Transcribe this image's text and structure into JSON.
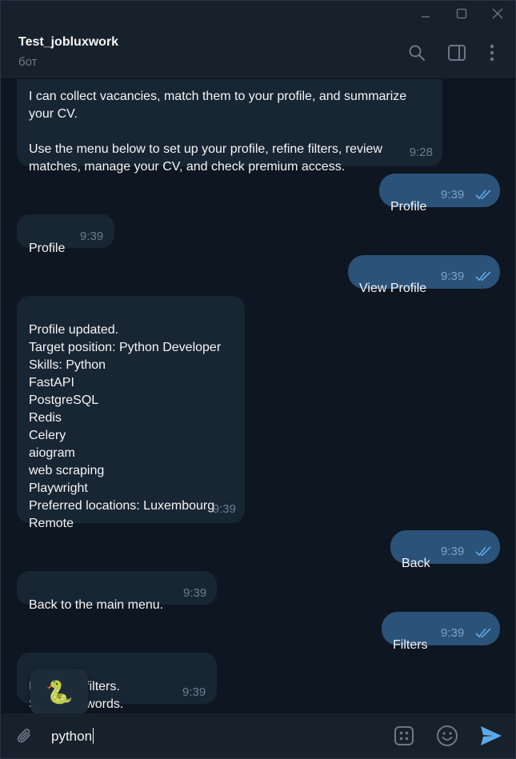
{
  "window": {
    "minimize_icon": "minimize-icon",
    "maximize_icon": "maximize-icon",
    "close_icon": "close-icon"
  },
  "header": {
    "title": "Test_jobluxwork",
    "subtitle": "бот",
    "icons": [
      "search-icon",
      "sidebar-toggle-icon",
      "more-vertical-icon"
    ]
  },
  "messages": [
    {
      "direction": "in",
      "text": "I can collect vacancies, match them to your profile, and summarize\nyour CV.\n\nUse the menu below to set up your profile, refine filters, review\nmatches, manage your CV, and check premium access.",
      "time": "9:28"
    },
    {
      "direction": "out",
      "text": "Profile",
      "time": "9:39"
    },
    {
      "direction": "in",
      "text": "Profile",
      "time": "9:39"
    },
    {
      "direction": "out",
      "text": "View Profile",
      "time": "9:39"
    },
    {
      "direction": "in",
      "text": "Profile updated.\nTarget position: Python Developer\nSkills: Python\nFastAPI\nPostgreSQL\nRedis\nCelery\naiogram\nweb scraping\nPlaywright\nPreferred locations: Luxembourg\nRemote",
      "time": "9:39"
    },
    {
      "direction": "out",
      "text": "Back",
      "time": "9:39"
    },
    {
      "direction": "in",
      "text": "Back to the main menu.",
      "time": "9:39"
    },
    {
      "direction": "out",
      "text": "Filters",
      "time": "9:39"
    },
    {
      "direction": "in",
      "text": "I      ate your filters.\nS       ude keywords.",
      "time": "9:39"
    }
  ],
  "sticker_suggestion": "🐍",
  "input": {
    "value": "python",
    "icons": [
      "attach-icon",
      "bot-commands-icon",
      "emoji-icon",
      "send-icon"
    ]
  },
  "colors": {
    "background": "#0e1621",
    "header": "#17212b",
    "incoming_bubble": "#182533",
    "outgoing_bubble": "#2b5278",
    "accent": "#5fa8e8"
  }
}
